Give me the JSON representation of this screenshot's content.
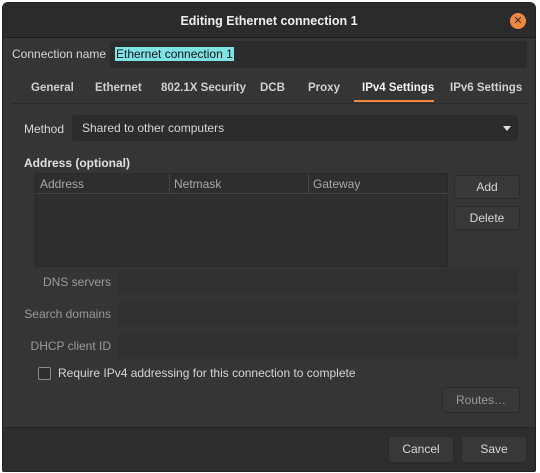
{
  "window": {
    "title": "Editing Ethernet connection 1",
    "close_symbol": "✕"
  },
  "connection": {
    "label": "Connection name",
    "value": "Ethernet connection 1"
  },
  "tabs": [
    {
      "label": "General"
    },
    {
      "label": "Ethernet"
    },
    {
      "label": "802.1X Security"
    },
    {
      "label": "DCB"
    },
    {
      "label": "Proxy"
    },
    {
      "label": "IPv4 Settings",
      "active": true
    },
    {
      "label": "IPv6 Settings"
    }
  ],
  "ipv4": {
    "method_label": "Method",
    "method_value": "Shared to other computers",
    "address_heading": "Address (optional)",
    "columns": [
      "Address",
      "Netmask",
      "Gateway"
    ],
    "add_label": "Add",
    "delete_label": "Delete",
    "dns_label": "DNS servers",
    "search_label": "Search domains",
    "dhcp_label": "DHCP client ID",
    "require_label": "Require IPv4 addressing for this connection to complete",
    "require_checked": false,
    "routes_label": "Routes…"
  },
  "footer": {
    "cancel_label": "Cancel",
    "save_label": "Save"
  },
  "colors": {
    "accent": "#f0883e",
    "background": "#353535",
    "selection": "#7fe3e6"
  }
}
